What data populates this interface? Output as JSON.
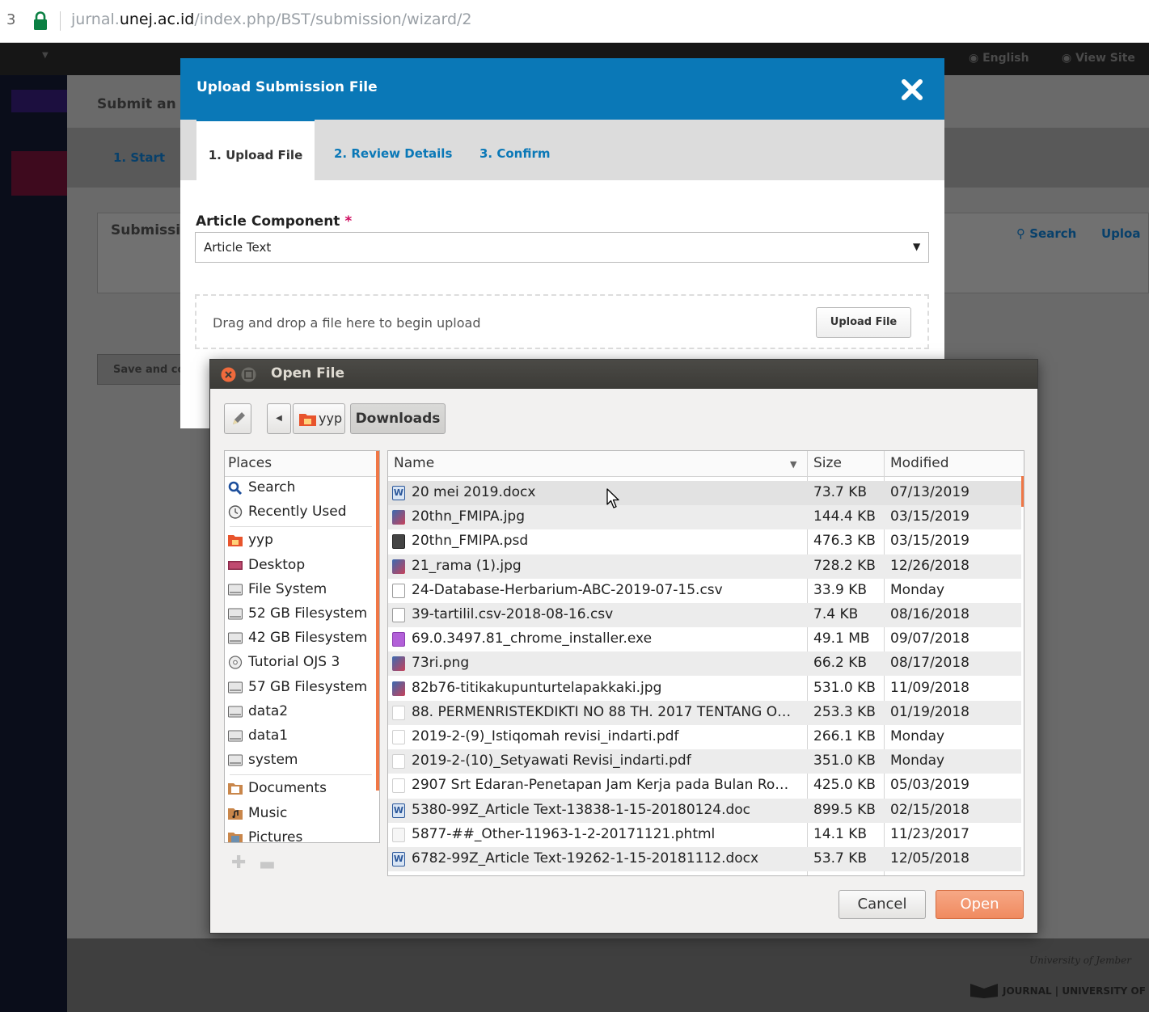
{
  "browser": {
    "left_edge_glyph": "3",
    "url_host_prefix": "jurnal.",
    "url_host_main": "unej.ac.id",
    "url_path": "/index.php/BST/submission/wizard/2"
  },
  "ojs": {
    "top_links": [
      "English",
      "View Site"
    ],
    "page_heading": "Submit an",
    "step_tab": "1. Start",
    "panel_title": "Submissi",
    "search_link": "Search",
    "upload_link": "Uploa",
    "save_button": "Save and co",
    "footer_line1": "University of Jember",
    "footer_line2": "JOURNAL | UNIVERSITY OF"
  },
  "modal": {
    "title": "Upload Submission File",
    "tabs": [
      "1. Upload File",
      "2. Review Details",
      "3. Confirm"
    ],
    "component_label": "Article Component",
    "required_mark": "*",
    "component_value": "Article Text",
    "dropzone_text": "Drag and drop a file here to begin upload",
    "upload_button": "Upload File"
  },
  "dialog": {
    "title": "Open File",
    "breadcrumbs": [
      "yyp",
      "Downloads"
    ],
    "places_header": "Places",
    "places": [
      {
        "label": "Search",
        "icon": "search-icon"
      },
      {
        "label": "Recently Used",
        "icon": "clock-icon"
      },
      {
        "label": "yyp",
        "icon": "home-folder-icon"
      },
      {
        "label": "Desktop",
        "icon": "desktop-icon"
      },
      {
        "label": "File System",
        "icon": "drive-icon"
      },
      {
        "label": "52 GB Filesystem",
        "icon": "drive-icon"
      },
      {
        "label": "42 GB Filesystem",
        "icon": "drive-icon"
      },
      {
        "label": "Tutorial OJS 3",
        "icon": "disc-icon"
      },
      {
        "label": "57 GB Filesystem",
        "icon": "drive-icon"
      },
      {
        "label": "data2",
        "icon": "drive-icon"
      },
      {
        "label": "data1",
        "icon": "drive-icon"
      },
      {
        "label": "system",
        "icon": "drive-icon"
      },
      {
        "label": "Documents",
        "icon": "documents-folder-icon"
      },
      {
        "label": "Music",
        "icon": "music-folder-icon"
      },
      {
        "label": "Pictures",
        "icon": "pictures-folder-icon"
      }
    ],
    "columns": {
      "name": "Name",
      "size": "Size",
      "modified": "Modified"
    },
    "files": [
      {
        "name": "20 mei 2019.docx",
        "size": "73.7 KB",
        "modified": "07/13/2019",
        "icon": "word-doc-icon"
      },
      {
        "name": "20thn_FMIPA.jpg",
        "size": "144.4 KB",
        "modified": "03/15/2019",
        "icon": "image-icon"
      },
      {
        "name": "20thn_FMIPA.psd",
        "size": "476.3 KB",
        "modified": "03/15/2019",
        "icon": "psd-icon"
      },
      {
        "name": "21_rama (1).jpg",
        "size": "728.2 KB",
        "modified": "12/26/2018",
        "icon": "image-icon"
      },
      {
        "name": "24-Database-Herbarium-ABC-2019-07-15.csv",
        "size": "33.9 KB",
        "modified": "Monday",
        "icon": "text-file-icon"
      },
      {
        "name": "39-tartilil.csv-2018-08-16.csv",
        "size": "7.4 KB",
        "modified": "08/16/2018",
        "icon": "text-file-icon"
      },
      {
        "name": "69.0.3497.81_chrome_installer.exe",
        "size": "49.1 MB",
        "modified": "09/07/2018",
        "icon": "exe-icon"
      },
      {
        "name": "73ri.png",
        "size": "66.2 KB",
        "modified": "08/17/2018",
        "icon": "image-icon"
      },
      {
        "name": "82b76-titikakupunturtelapakkaki.jpg",
        "size": "531.0 KB",
        "modified": "11/09/2018",
        "icon": "image-icon"
      },
      {
        "name": "88. PERMENRISTEKDIKTI NO 88 TH. 2017 TENTANG O…",
        "size": "253.3 KB",
        "modified": "01/19/2018",
        "icon": "pdf-icon"
      },
      {
        "name": "2019-2-(9)_Istiqomah revisi_indarti.pdf",
        "size": "266.1 KB",
        "modified": "Monday",
        "icon": "pdf-icon"
      },
      {
        "name": "2019-2-(10)_Setyawati Revisi_indarti.pdf",
        "size": "351.0 KB",
        "modified": "Monday",
        "icon": "pdf-icon"
      },
      {
        "name": "2907 Srt Edaran-Penetapan Jam Kerja pada Bulan Ro…",
        "size": "425.0 KB",
        "modified": "05/03/2019",
        "icon": "pdf-icon"
      },
      {
        "name": "5380-99Z_Article Text-13838-1-15-20180124.doc",
        "size": "899.5 KB",
        "modified": "02/15/2018",
        "icon": "word-doc-icon"
      },
      {
        "name": "5877-##_Other-11963-1-2-20171121.phtml",
        "size": "14.1 KB",
        "modified": "11/23/2017",
        "icon": "html-file-icon"
      },
      {
        "name": "6782-99Z_Article Text-19262-1-15-20181112.docx",
        "size": "53.7 KB",
        "modified": "12/05/2018",
        "icon": "word-doc-icon"
      }
    ],
    "cancel_button": "Cancel",
    "open_button": "Open"
  },
  "colors": {
    "modal_header": "#0a78b7",
    "required": "#d00c5f",
    "accent_orange": "#f07746"
  }
}
